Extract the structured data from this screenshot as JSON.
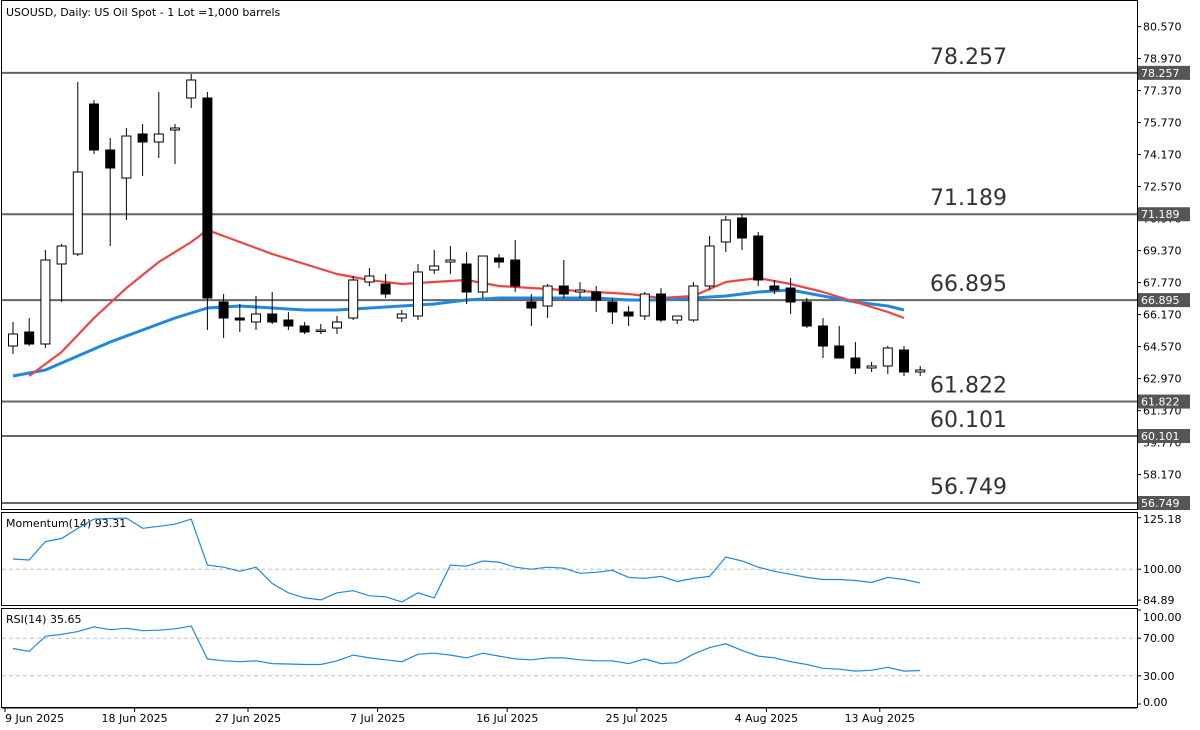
{
  "chart_data": [
    {
      "type": "candlestick",
      "title": "USOUSD, Daily:  US Oil Spot - 1 Lot =1,000 barrels",
      "y_ticks": [
        "80.570",
        "78.970",
        "77.370",
        "75.770",
        "74.170",
        "72.570",
        "70.970",
        "69.370",
        "67.770",
        "66.170",
        "64.570",
        "62.970",
        "61.370",
        "59.770",
        "58.170"
      ],
      "ylim": [
        56.5,
        81.8
      ],
      "levels": [
        {
          "value": 78.257,
          "label": "78.257"
        },
        {
          "value": 71.189,
          "label": "71.189"
        },
        {
          "value": 66.895,
          "label": "66.895"
        },
        {
          "value": 61.822,
          "label": "61.822"
        },
        {
          "value": 60.101,
          "label": "60.101"
        },
        {
          "value": 56.749,
          "label": "56.749"
        }
      ],
      "x_labels": [
        {
          "label": "9 Jun 2025",
          "index": 0
        },
        {
          "label": "18 Jun 2025",
          "index": 8
        },
        {
          "label": "27 Jun 2025",
          "index": 15
        },
        {
          "label": "7 Jul 2025",
          "index": 23
        },
        {
          "label": "16 Jul 2025",
          "index": 31
        },
        {
          "label": "25 Jul 2025",
          "index": 39
        },
        {
          "label": "4 Aug 2025",
          "index": 47
        },
        {
          "label": "13 Aug 2025",
          "index": 54
        }
      ],
      "candles": [
        {
          "o": 64.6,
          "h": 65.8,
          "l": 64.2,
          "c": 65.2
        },
        {
          "o": 65.3,
          "h": 66.0,
          "l": 64.6,
          "c": 64.7
        },
        {
          "o": 64.7,
          "h": 69.4,
          "l": 64.5,
          "c": 68.9
        },
        {
          "o": 68.7,
          "h": 69.7,
          "l": 66.8,
          "c": 69.6
        },
        {
          "o": 69.2,
          "h": 77.8,
          "l": 69.1,
          "c": 73.3
        },
        {
          "o": 76.7,
          "h": 76.9,
          "l": 74.2,
          "c": 74.4
        },
        {
          "o": 74.4,
          "h": 75.0,
          "l": 69.6,
          "c": 73.5
        },
        {
          "o": 73.0,
          "h": 75.5,
          "l": 70.9,
          "c": 75.1
        },
        {
          "o": 75.2,
          "h": 75.7,
          "l": 73.1,
          "c": 74.8
        },
        {
          "o": 74.8,
          "h": 77.3,
          "l": 74.0,
          "c": 75.2
        },
        {
          "o": 75.4,
          "h": 75.7,
          "l": 73.7,
          "c": 75.5
        },
        {
          "o": 77.0,
          "h": 78.2,
          "l": 76.5,
          "c": 77.9
        },
        {
          "o": 77.0,
          "h": 77.3,
          "l": 65.4,
          "c": 67.0
        },
        {
          "o": 66.8,
          "h": 67.2,
          "l": 65.0,
          "c": 66.0
        },
        {
          "o": 66.0,
          "h": 66.7,
          "l": 65.3,
          "c": 65.9
        },
        {
          "o": 65.8,
          "h": 67.1,
          "l": 65.4,
          "c": 66.2
        },
        {
          "o": 66.2,
          "h": 67.3,
          "l": 65.7,
          "c": 65.8
        },
        {
          "o": 65.9,
          "h": 66.3,
          "l": 65.4,
          "c": 65.6
        },
        {
          "o": 65.6,
          "h": 65.8,
          "l": 65.2,
          "c": 65.3
        },
        {
          "o": 65.4,
          "h": 65.7,
          "l": 65.2,
          "c": 65.4
        },
        {
          "o": 65.5,
          "h": 66.1,
          "l": 65.2,
          "c": 65.8
        },
        {
          "o": 66.0,
          "h": 68.1,
          "l": 65.9,
          "c": 67.9
        },
        {
          "o": 67.8,
          "h": 68.5,
          "l": 67.6,
          "c": 68.1
        },
        {
          "o": 67.7,
          "h": 68.2,
          "l": 67.0,
          "c": 67.2
        },
        {
          "o": 66.0,
          "h": 66.4,
          "l": 65.8,
          "c": 66.2
        },
        {
          "o": 66.1,
          "h": 68.7,
          "l": 65.9,
          "c": 68.3
        },
        {
          "o": 68.4,
          "h": 69.4,
          "l": 68.2,
          "c": 68.6
        },
        {
          "o": 68.8,
          "h": 69.6,
          "l": 68.2,
          "c": 68.9
        },
        {
          "o": 68.7,
          "h": 69.3,
          "l": 66.7,
          "c": 67.3
        },
        {
          "o": 67.3,
          "h": 69.0,
          "l": 67.0,
          "c": 69.1
        },
        {
          "o": 69.0,
          "h": 69.2,
          "l": 68.5,
          "c": 68.8
        },
        {
          "o": 68.9,
          "h": 69.9,
          "l": 67.3,
          "c": 67.6
        },
        {
          "o": 66.8,
          "h": 67.2,
          "l": 65.6,
          "c": 66.5
        },
        {
          "o": 66.6,
          "h": 67.7,
          "l": 66.0,
          "c": 67.6
        },
        {
          "o": 67.6,
          "h": 68.9,
          "l": 67.0,
          "c": 67.2
        },
        {
          "o": 67.3,
          "h": 67.8,
          "l": 67.0,
          "c": 67.4
        },
        {
          "o": 67.3,
          "h": 67.6,
          "l": 66.3,
          "c": 66.9
        },
        {
          "o": 66.8,
          "h": 67.0,
          "l": 65.7,
          "c": 66.3
        },
        {
          "o": 66.3,
          "h": 66.6,
          "l": 65.6,
          "c": 66.1
        },
        {
          "o": 66.1,
          "h": 67.3,
          "l": 65.9,
          "c": 67.2
        },
        {
          "o": 67.2,
          "h": 67.5,
          "l": 65.8,
          "c": 65.9
        },
        {
          "o": 65.9,
          "h": 66.1,
          "l": 65.7,
          "c": 66.1
        },
        {
          "o": 65.9,
          "h": 67.8,
          "l": 65.8,
          "c": 67.6
        },
        {
          "o": 67.6,
          "h": 70.1,
          "l": 67.4,
          "c": 69.6
        },
        {
          "o": 69.8,
          "h": 71.1,
          "l": 69.3,
          "c": 70.9
        },
        {
          "o": 71.0,
          "h": 71.2,
          "l": 69.4,
          "c": 70.0
        },
        {
          "o": 70.1,
          "h": 70.3,
          "l": 67.6,
          "c": 67.9
        },
        {
          "o": 67.6,
          "h": 67.9,
          "l": 67.2,
          "c": 67.4
        },
        {
          "o": 67.5,
          "h": 68.0,
          "l": 66.2,
          "c": 66.8
        },
        {
          "o": 66.8,
          "h": 67.0,
          "l": 65.5,
          "c": 65.6
        },
        {
          "o": 65.6,
          "h": 66.0,
          "l": 64.0,
          "c": 64.6
        },
        {
          "o": 64.6,
          "h": 65.6,
          "l": 64.1,
          "c": 64.0
        },
        {
          "o": 64.0,
          "h": 64.8,
          "l": 63.2,
          "c": 63.5
        },
        {
          "o": 63.5,
          "h": 63.8,
          "l": 63.3,
          "c": 63.6
        },
        {
          "o": 63.6,
          "h": 64.6,
          "l": 63.2,
          "c": 64.5
        },
        {
          "o": 64.4,
          "h": 64.6,
          "l": 63.1,
          "c": 63.3
        },
        {
          "o": 63.3,
          "h": 63.6,
          "l": 63.1,
          "c": 63.4
        }
      ],
      "ma_fast": {
        "color": "#ee4444",
        "points": [
          [
            1,
            63.1
          ],
          [
            3,
            64.3
          ],
          [
            5,
            66.0
          ],
          [
            7,
            67.5
          ],
          [
            9,
            68.8
          ],
          [
            11,
            69.8
          ],
          [
            12,
            70.4
          ],
          [
            14,
            69.8
          ],
          [
            16,
            69.2
          ],
          [
            18,
            68.7
          ],
          [
            20,
            68.2
          ],
          [
            22,
            67.9
          ],
          [
            24,
            67.7
          ],
          [
            26,
            67.8
          ],
          [
            28,
            67.9
          ],
          [
            30,
            67.6
          ],
          [
            32,
            67.5
          ],
          [
            34,
            67.4
          ],
          [
            36,
            67.3
          ],
          [
            38,
            67.2
          ],
          [
            40,
            67.0
          ],
          [
            42,
            67.1
          ],
          [
            44,
            67.8
          ],
          [
            46,
            68.0
          ],
          [
            48,
            67.7
          ],
          [
            50,
            67.3
          ],
          [
            52,
            66.8
          ],
          [
            54,
            66.3
          ],
          [
            55,
            66.0
          ]
        ]
      },
      "ma_slow": {
        "color": "#2288dd",
        "points": [
          [
            0,
            63.1
          ],
          [
            2,
            63.4
          ],
          [
            4,
            64.1
          ],
          [
            6,
            64.8
          ],
          [
            8,
            65.4
          ],
          [
            10,
            66.0
          ],
          [
            12,
            66.5
          ],
          [
            14,
            66.6
          ],
          [
            16,
            66.5
          ],
          [
            18,
            66.4
          ],
          [
            20,
            66.4
          ],
          [
            22,
            66.5
          ],
          [
            24,
            66.6
          ],
          [
            26,
            66.7
          ],
          [
            28,
            66.9
          ],
          [
            30,
            67.0
          ],
          [
            32,
            67.0
          ],
          [
            34,
            67.0
          ],
          [
            36,
            67.0
          ],
          [
            38,
            66.9
          ],
          [
            40,
            66.9
          ],
          [
            42,
            67.0
          ],
          [
            44,
            67.1
          ],
          [
            46,
            67.3
          ],
          [
            48,
            67.4
          ],
          [
            50,
            67.1
          ],
          [
            52,
            66.8
          ],
          [
            54,
            66.6
          ],
          [
            55,
            66.4
          ]
        ]
      }
    },
    {
      "type": "line",
      "title": "Momentum(14) 93.31",
      "y_ticks": [
        "125.18",
        "100.00",
        "84.89"
      ],
      "ylim": [
        83.0,
        127.0
      ],
      "ref_line": 100.0,
      "color": "#2288dd",
      "series": [
        [
          0,
          105.0
        ],
        [
          1,
          104.5
        ],
        [
          2,
          113.5
        ],
        [
          3,
          115.0
        ],
        [
          4,
          120.0
        ],
        [
          5,
          124.5
        ],
        [
          6,
          124.8
        ],
        [
          7,
          125.0
        ],
        [
          8,
          120.0
        ],
        [
          9,
          121.0
        ],
        [
          10,
          122.0
        ],
        [
          11,
          124.5
        ],
        [
          12,
          102.0
        ],
        [
          13,
          101.0
        ],
        [
          14,
          99.0
        ],
        [
          15,
          101.0
        ],
        [
          16,
          93.0
        ],
        [
          17,
          88.5
        ],
        [
          18,
          86.0
        ],
        [
          19,
          85.0
        ],
        [
          20,
          88.5
        ],
        [
          21,
          89.5
        ],
        [
          22,
          87.0
        ],
        [
          23,
          86.5
        ],
        [
          24,
          84.0
        ],
        [
          25,
          88.5
        ],
        [
          26,
          86.0
        ],
        [
          27,
          102.0
        ],
        [
          28,
          101.5
        ],
        [
          29,
          104.0
        ],
        [
          30,
          103.5
        ],
        [
          31,
          101.0
        ],
        [
          32,
          100.0
        ],
        [
          33,
          101.0
        ],
        [
          34,
          100.5
        ],
        [
          35,
          98.0
        ],
        [
          36,
          98.5
        ],
        [
          37,
          99.5
        ],
        [
          38,
          96.0
        ],
        [
          39,
          95.5
        ],
        [
          40,
          96.5
        ],
        [
          41,
          94.0
        ],
        [
          42,
          95.5
        ],
        [
          43,
          96.5
        ],
        [
          44,
          106.0
        ],
        [
          45,
          104.0
        ],
        [
          46,
          101.0
        ],
        [
          47,
          99.0
        ],
        [
          48,
          97.5
        ],
        [
          49,
          96.0
        ],
        [
          50,
          95.0
        ],
        [
          51,
          95.0
        ],
        [
          52,
          94.5
        ],
        [
          53,
          93.5
        ],
        [
          54,
          96.0
        ],
        [
          55,
          95.0
        ],
        [
          56,
          93.3
        ]
      ]
    },
    {
      "type": "line",
      "title": "RSI(14) 35.65",
      "y_ticks": [
        "100.00",
        "70.00",
        "30.00",
        "0.00"
      ],
      "ylim": [
        0,
        100
      ],
      "ref_lines": [
        70,
        30
      ],
      "color": "#2288dd",
      "series": [
        [
          0,
          59.0
        ],
        [
          1,
          56.0
        ],
        [
          2,
          72.0
        ],
        [
          3,
          74.0
        ],
        [
          4,
          77.0
        ],
        [
          5,
          82.0
        ],
        [
          6,
          79.0
        ],
        [
          7,
          80.5
        ],
        [
          8,
          78.0
        ],
        [
          9,
          78.5
        ],
        [
          10,
          80.0
        ],
        [
          11,
          83.0
        ],
        [
          12,
          48.0
        ],
        [
          13,
          46.0
        ],
        [
          14,
          45.0
        ],
        [
          15,
          46.0
        ],
        [
          16,
          43.0
        ],
        [
          17,
          42.5
        ],
        [
          18,
          42.0
        ],
        [
          19,
          42.0
        ],
        [
          20,
          46.0
        ],
        [
          21,
          52.0
        ],
        [
          22,
          49.0
        ],
        [
          23,
          47.0
        ],
        [
          24,
          45.0
        ],
        [
          25,
          53.0
        ],
        [
          26,
          54.0
        ],
        [
          27,
          52.0
        ],
        [
          28,
          49.0
        ],
        [
          29,
          54.0
        ],
        [
          30,
          51.0
        ],
        [
          31,
          48.0
        ],
        [
          32,
          47.0
        ],
        [
          33,
          49.0
        ],
        [
          34,
          49.0
        ],
        [
          35,
          47.0
        ],
        [
          36,
          46.0
        ],
        [
          37,
          46.0
        ],
        [
          38,
          43.0
        ],
        [
          39,
          48.0
        ],
        [
          40,
          43.0
        ],
        [
          41,
          44.0
        ],
        [
          42,
          53.0
        ],
        [
          43,
          60.0
        ],
        [
          44,
          64.0
        ],
        [
          45,
          57.0
        ],
        [
          46,
          51.0
        ],
        [
          47,
          49.0
        ],
        [
          48,
          45.0
        ],
        [
          49,
          42.0
        ],
        [
          50,
          38.0
        ],
        [
          51,
          37.0
        ],
        [
          52,
          35.0
        ],
        [
          53,
          36.0
        ],
        [
          54,
          39.0
        ],
        [
          55,
          35.0
        ],
        [
          56,
          35.65
        ]
      ]
    }
  ],
  "colors": {
    "axis": "#000000",
    "level_line": "#666666",
    "tag_bg": "#555555",
    "grid_dash": "#c0c0c0"
  }
}
